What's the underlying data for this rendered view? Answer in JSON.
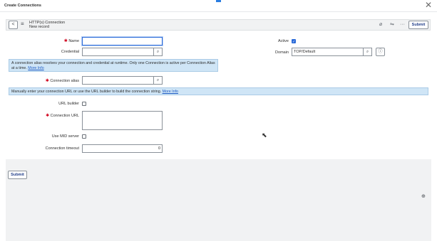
{
  "dialog": {
    "title": "Create Connections",
    "close_glyph": "✕"
  },
  "header": {
    "back_glyph": "<",
    "menu_glyph": "≡",
    "title": "HTTP(s) Connection",
    "subtitle": "New record",
    "attach_glyph": "⌀",
    "settings_glyph": "⇋",
    "more_glyph": "···",
    "submit_label": "Submit"
  },
  "form": {
    "name": {
      "label": "Name",
      "required_mark": "✱",
      "value": ""
    },
    "credential": {
      "label": "Credential",
      "value": "",
      "search_glyph": "⌕"
    },
    "alias_info": {
      "text": "A connection alias resolves your connection and credential at runtime. Only one Connection is active per Connection Alias at a time.",
      "link": "More Info"
    },
    "connection_alias": {
      "label": "Connection alias",
      "required_mark": "✱",
      "value": "",
      "search_glyph": "⌕"
    },
    "url_info": {
      "text": "Manually enter your connection URL or use the URL builder to build the connection string.",
      "link": "More Info"
    },
    "url_builder": {
      "label": "URL builder",
      "checked": false
    },
    "connection_url": {
      "label": "Connection URL",
      "required_mark": "✱",
      "value": ""
    },
    "use_mid_server": {
      "label": "Use MID server",
      "checked": false
    },
    "connection_timeout": {
      "label": "Connection timeout",
      "value": "0"
    },
    "active": {
      "label": "Active",
      "checked": true,
      "check_glyph": "✓"
    },
    "domain": {
      "label": "Domain",
      "value": "TOP/Default",
      "search_glyph": "⌕",
      "info_glyph": "ⓘ"
    }
  },
  "footer": {
    "submit_label": "Submit",
    "scroll_glyph": "⊕"
  },
  "colors": {
    "accent": "#2a6ad8",
    "info_bg": "#cfe5f6",
    "required": "#d0021b"
  }
}
